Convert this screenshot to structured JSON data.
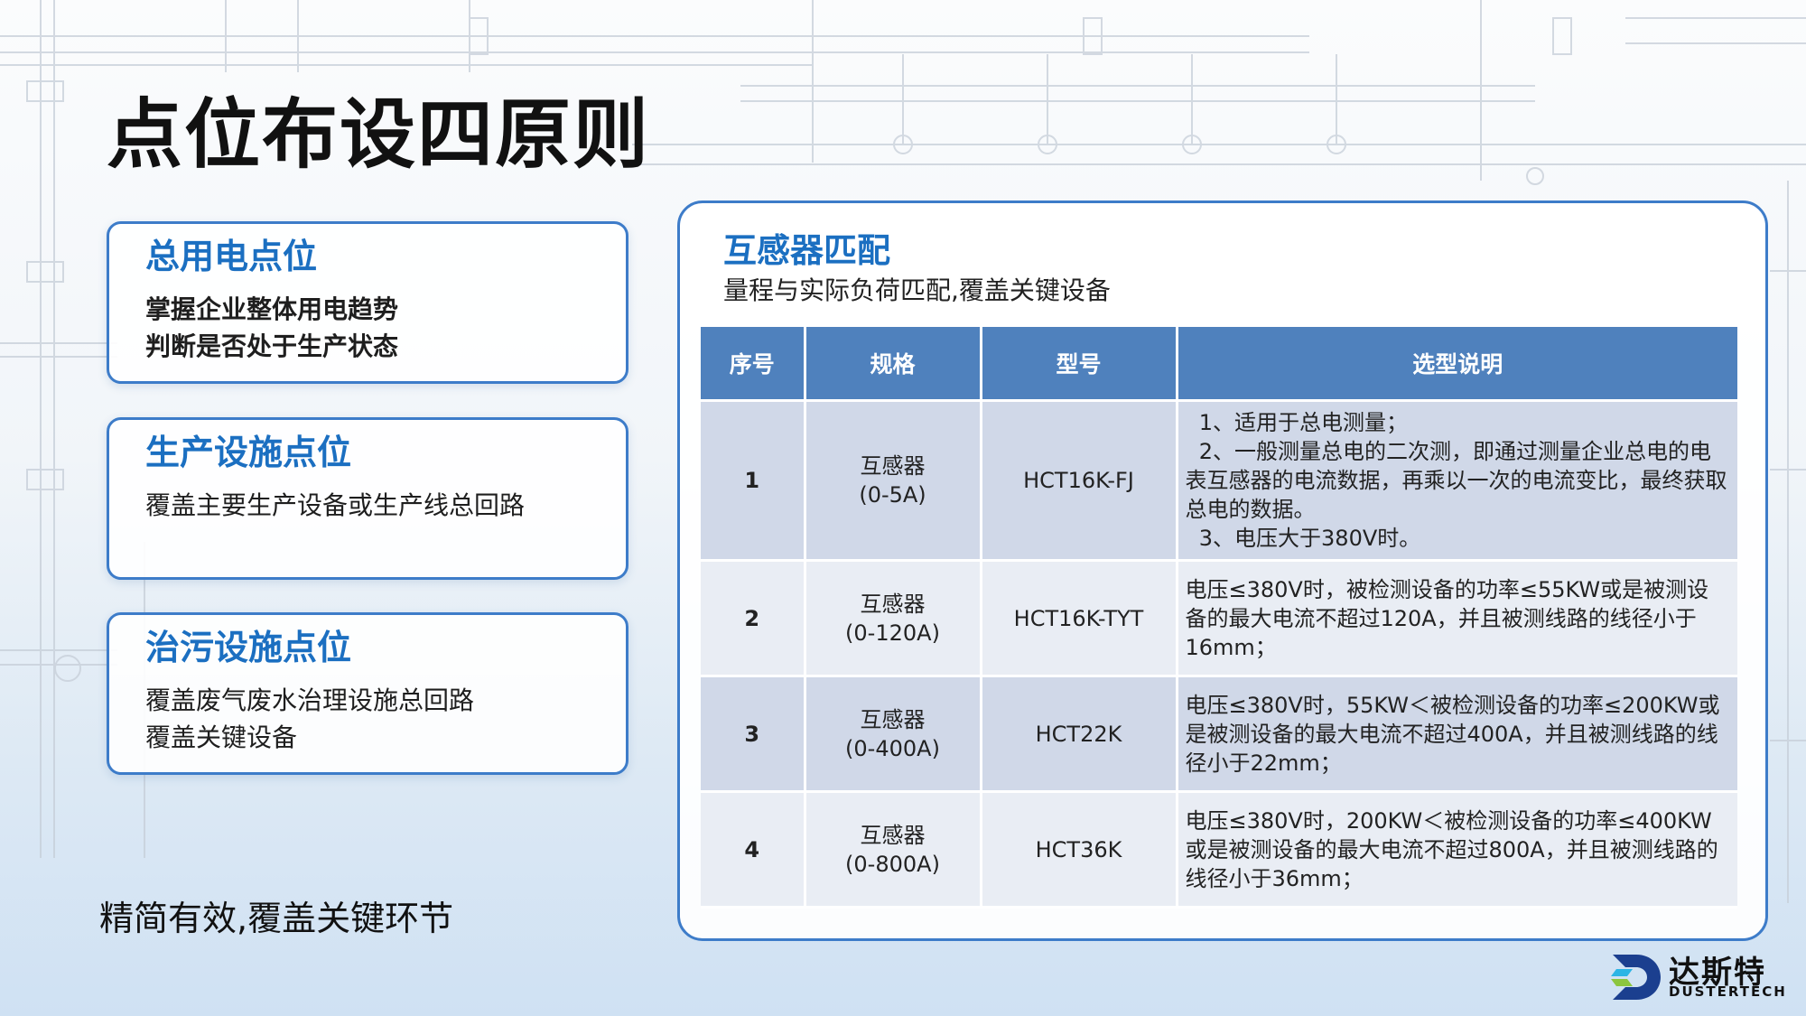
{
  "title": "点位布设四原则",
  "cards": [
    {
      "title": "总用电点位",
      "lines": [
        "掌握企业整体用电趋势",
        "判断是否处于生产状态"
      ]
    },
    {
      "title": "生产设施点位",
      "lines": [
        "覆盖主要生产设备或生产线总回路"
      ]
    },
    {
      "title": "治污设施点位",
      "lines": [
        "覆盖废气废水治理设施总回路",
        "覆盖关键设备"
      ]
    }
  ],
  "slogan": "精简有效,覆盖关键环节",
  "panel": {
    "title": "互感器匹配",
    "subtitle": "量程与实际负荷匹配,覆盖关键设备",
    "table": {
      "headers": [
        "序号",
        "规格",
        "型号",
        "选型说明"
      ],
      "rows": [
        {
          "seq": "1",
          "spec": [
            "互感器",
            "(0-5A)"
          ],
          "model": "HCT16K-FJ",
          "desc": [
            "  1、适用于总电测量；",
            "  2、一般测量总电的二次测，即通过测量企业总电的电表互感器的电流数据，再乘以一次的电流变比，最终获取总电的数据。",
            "  3、电压大于380V时。"
          ]
        },
        {
          "seq": "2",
          "spec": [
            "互感器",
            "(0-120A)"
          ],
          "model": "HCT16K-TYT",
          "desc": [
            "电压≤380V时，被检测设备的功率≤55KW或是被测设备的最大电流不超过120A，并且被测线路的线径小于16mm；"
          ]
        },
        {
          "seq": "3",
          "spec": [
            "互感器",
            "(0-400A)"
          ],
          "model": "HCT22K",
          "desc": [
            "电压≤380V时，55KW＜被检测设备的功率≤200KW或是被测设备的最大电流不超过400A，并且被测线路的线径小于22mm；"
          ]
        },
        {
          "seq": "4",
          "spec": [
            "互感器",
            "(0-800A)"
          ],
          "model": "HCT36K",
          "desc": [
            "电压≤380V时，200KW＜被检测设备的功率≤400KW或是被测设备的最大电流不超过800A，并且被测线路的线径小于36mm；"
          ]
        }
      ]
    }
  },
  "logo": {
    "cn": "达斯特",
    "en": "DUSTERTECH"
  },
  "colors": {
    "accent": "#1b6fc1",
    "border": "#3d7cc9",
    "table_header": "#4f81bd",
    "row_odd": "#d0d8e8",
    "row_even": "#e9edf4"
  }
}
